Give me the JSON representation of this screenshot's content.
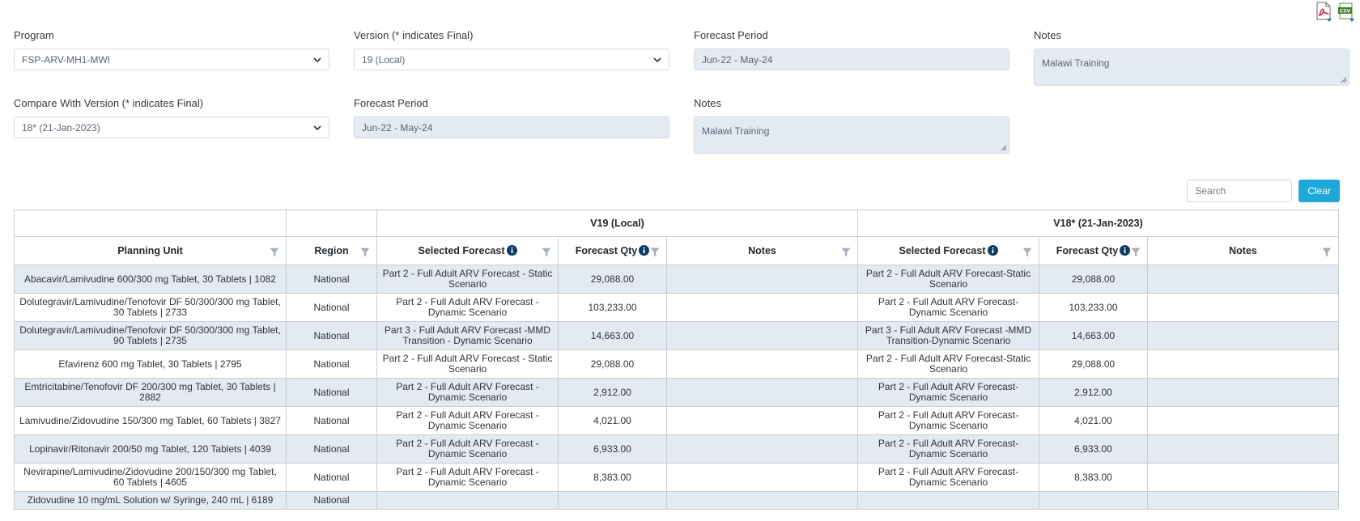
{
  "filters": {
    "program_label": "Program",
    "program_value": "FSP-ARV-MH1-MWI",
    "version_label": "Version (* indicates Final)",
    "version_value": "19 (Local)",
    "forecast_period_label": "Forecast Period",
    "forecast_period_value": "Jun-22 - May-24",
    "notes_label": "Notes",
    "notes_value": "Malawi Training",
    "compare_label": "Compare With Version (* indicates Final)",
    "compare_value": "18* (21-Jan-2023)",
    "compare_period_label": "Forecast Period",
    "compare_period_value": "Jun-22 - May-24",
    "compare_notes_label": "Notes",
    "compare_notes_value": "Malawi Training"
  },
  "toolbar": {
    "search_placeholder": "Search",
    "clear_label": "Clear"
  },
  "icons": {
    "pdf": "pdf-export-icon",
    "csv": "csv-export-icon",
    "filter": "filter-icon",
    "info": "info-icon",
    "dropdown": "chevron-down-icon"
  },
  "table": {
    "group_v1": "V19 (Local)",
    "group_v2": "V18* (21-Jan-2023)",
    "headers": {
      "planning_unit": "Planning Unit",
      "region": "Region",
      "selected_forecast": "Selected Forecast",
      "forecast_qty": "Forecast Qty",
      "notes": "Notes"
    },
    "rows": [
      {
        "pu": "Abacavir/Lamivudine 600/300 mg Tablet, 30 Tablets | 1082",
        "region": "National",
        "sf1": "Part 2 - Full Adult ARV Forecast - Static Scenario",
        "qty1": "29,088.00",
        "notes1": "",
        "sf2": "Part 2 - Full Adult ARV Forecast-Static Scenario",
        "qty2": "29,088.00",
        "notes2": ""
      },
      {
        "pu": "Dolutegravir/Lamivudine/Tenofovir DF 50/300/300 mg Tablet, 30 Tablets | 2733",
        "region": "National",
        "sf1": "Part 2 - Full Adult ARV Forecast - Dynamic Scenario",
        "qty1": "103,233.00",
        "notes1": "",
        "sf2": "Part 2 - Full Adult ARV Forecast-Dynamic Scenario",
        "qty2": "103,233.00",
        "notes2": ""
      },
      {
        "pu": "Dolutegravir/Lamivudine/Tenofovir DF 50/300/300 mg Tablet, 90 Tablets | 2735",
        "region": "National",
        "sf1": "Part 3 - Full Adult ARV Forecast -MMD Transition - Dynamic Scenario",
        "qty1": "14,663.00",
        "notes1": "",
        "sf2": "Part 3 - Full Adult ARV Forecast -MMD Transition-Dynamic Scenario",
        "qty2": "14,663.00",
        "notes2": ""
      },
      {
        "pu": "Efavirenz 600 mg Tablet, 30 Tablets | 2795",
        "region": "National",
        "sf1": "Part 2 - Full Adult ARV Forecast - Static Scenario",
        "qty1": "29,088.00",
        "notes1": "",
        "sf2": "Part 2 - Full Adult ARV Forecast-Static Scenario",
        "qty2": "29,088.00",
        "notes2": ""
      },
      {
        "pu": "Emtricitabine/Tenofovir DF 200/300 mg Tablet, 30 Tablets | 2882",
        "region": "National",
        "sf1": "Part 2 - Full Adult ARV Forecast - Dynamic Scenario",
        "qty1": "2,912.00",
        "notes1": "",
        "sf2": "Part 2 - Full Adult ARV Forecast-Dynamic Scenario",
        "qty2": "2,912.00",
        "notes2": ""
      },
      {
        "pu": "Lamivudine/Zidovudine 150/300 mg Tablet, 60 Tablets | 3827",
        "region": "National",
        "sf1": "Part 2 - Full Adult ARV Forecast - Dynamic Scenario",
        "qty1": "4,021.00",
        "notes1": "",
        "sf2": "Part 2 - Full Adult ARV Forecast-Dynamic Scenario",
        "qty2": "4,021.00",
        "notes2": ""
      },
      {
        "pu": "Lopinavir/Ritonavir 200/50 mg Tablet, 120 Tablets | 4039",
        "region": "National",
        "sf1": "Part 2 - Full Adult ARV Forecast - Dynamic Scenario",
        "qty1": "6,933.00",
        "notes1": "",
        "sf2": "Part 2 - Full Adult ARV Forecast-Dynamic Scenario",
        "qty2": "6,933.00",
        "notes2": ""
      },
      {
        "pu": "Nevirapine/Lamivudine/Zidovudine 200/150/300 mg Tablet, 60 Tablets | 4605",
        "region": "National",
        "sf1": "Part 2 - Full Adult ARV Forecast - Dynamic Scenario",
        "qty1": "8,383.00",
        "notes1": "",
        "sf2": "Part 2 - Full Adult ARV Forecast-Dynamic Scenario",
        "qty2": "8,383.00",
        "notes2": ""
      },
      {
        "pu": "Zidovudine 10 mg/mL Solution w/ Syringe, 240 mL | 6189",
        "region": "National",
        "sf1": "",
        "qty1": "",
        "notes1": "",
        "sf2": "",
        "qty2": "",
        "notes2": ""
      }
    ]
  }
}
